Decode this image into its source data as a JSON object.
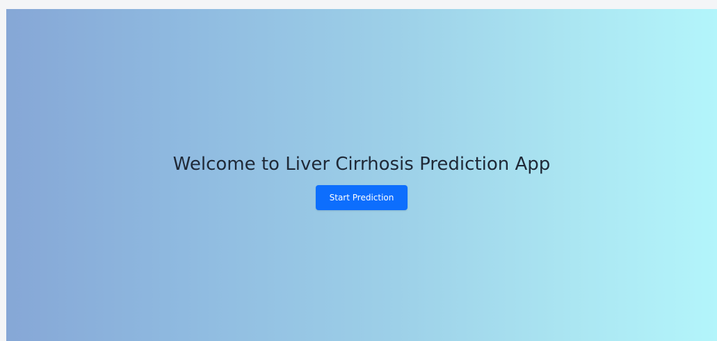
{
  "hero": {
    "title": "Welcome to Liver Cirrhosis Prediction App",
    "button_label": "Start Prediction"
  },
  "colors": {
    "gradient_start": "#86a7d6",
    "gradient_end": "#b3f5fb",
    "button_bg": "#0d6efd",
    "title_text": "#1f2937"
  }
}
